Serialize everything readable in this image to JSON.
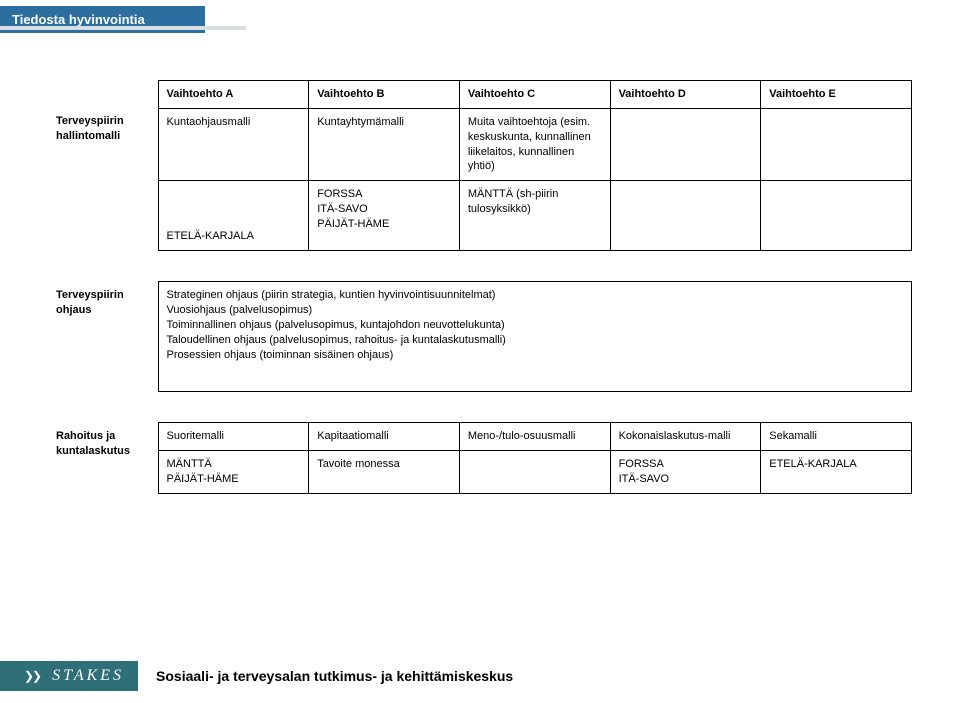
{
  "header": {
    "tab": "Tiedosta hyvinvointia"
  },
  "table1": {
    "cols": [
      "A",
      "B",
      "C",
      "D",
      "E"
    ],
    "col_headers": [
      "Vaihtoehto A",
      "Vaihtoehto B",
      "Vaihtoehto C",
      "Vaihtoehto D",
      "Vaihtoehto E"
    ],
    "row1": {
      "label": "Terveyspiirin hallintomalli",
      "cells": [
        "Kuntaohjausmalli",
        "Kuntayhtymämalli",
        "Muita vaihtoehtoja (esim. keskuskunta, kunnallinen liikelaitos, kunnallinen yhtiö)",
        "",
        ""
      ]
    },
    "row2": {
      "label": "",
      "cells": [
        "ETELÄ-KARJALA",
        "FORSSA\nITÄ-SAVO\nPÄIJÄT-HÄME",
        "MÄNTTÄ (sh-piirin tulosyksikkö)",
        "",
        ""
      ]
    }
  },
  "table2": {
    "row1": {
      "label": "Terveyspiirin ohjaus",
      "merged": "Strateginen ohjaus (piirin strategia, kuntien hyvinvointisuunnitelmat)\nVuosiohjaus (palvelusopimus)\nToiminnallinen ohjaus (palvelusopimus, kuntajohdon neuvottelukunta)\nTaloudellinen ohjaus (palvelusopimus, rahoitus- ja kuntalaskutusmalli)\nProsessien ohjaus (toiminnan sisäinen ohjaus)"
    }
  },
  "table3": {
    "row1": {
      "label": "Rahoitus ja kuntalaskutus",
      "cells": [
        "Suoritemalli",
        "Kapitaatiomalli",
        "Meno-/tulo-osuusmalli",
        "Kokonaislaskutus-malli",
        "Sekamalli"
      ]
    },
    "row2": {
      "label": "",
      "cells": [
        "MÄNTTÄ\nPÄIJÄT-HÄME",
        "Tavoite monessa",
        "",
        "FORSSA\nITÄ-SAVO",
        "ETELÄ-KARJALA"
      ]
    }
  },
  "footer": {
    "logo": "STAKES",
    "text": "Sosiaali- ja terveysalan tutkimus- ja kehittämiskeskus"
  }
}
